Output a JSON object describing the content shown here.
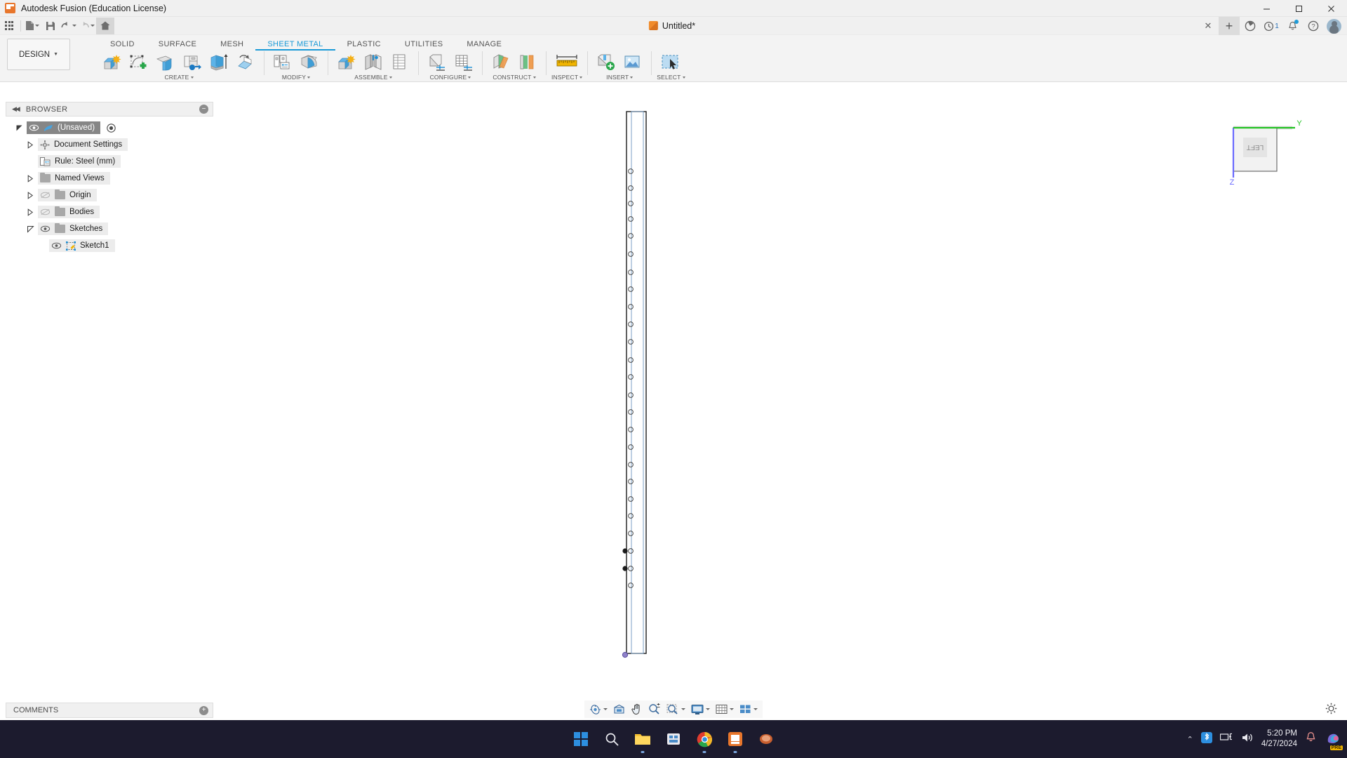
{
  "window": {
    "title": "Autodesk Fusion (Education License)",
    "logo_icon": "fusion-logo-icon",
    "controls": [
      {
        "name": "minimize",
        "glyph": "─"
      },
      {
        "name": "maximize",
        "glyph": "❐"
      },
      {
        "name": "close",
        "glyph": "✕"
      }
    ]
  },
  "quick_access": {
    "items": [
      {
        "name": "app-grid",
        "icon": "grid-icon",
        "caret": false
      },
      {
        "name": "new-document",
        "icon": "file-icon",
        "caret": true
      },
      {
        "name": "save",
        "icon": "save-icon",
        "caret": false
      },
      {
        "name": "undo",
        "icon": "undo-icon",
        "caret": true
      },
      {
        "name": "redo",
        "icon": "redo-icon",
        "caret": true
      },
      {
        "name": "home",
        "icon": "home-icon",
        "caret": false
      }
    ]
  },
  "document_tab": {
    "label": "Untitled*",
    "icon": "document-cube-icon",
    "close_glyph": "✕",
    "new_tab_glyph": "+"
  },
  "tabs_right": {
    "extension_icon": "extension-icon",
    "job_status_icon": "job-status-icon",
    "job_count": "1",
    "notifications_icon": "bell-icon",
    "help_icon": "help-icon",
    "account_icon": "avatar"
  },
  "ribbon": {
    "workspace_label": "DESIGN",
    "workspace_caret": "▼",
    "tabs": [
      {
        "label": "SOLID",
        "active": false
      },
      {
        "label": "SURFACE",
        "active": false
      },
      {
        "label": "MESH",
        "active": false
      },
      {
        "label": "SHEET METAL",
        "active": true
      },
      {
        "label": "PLASTIC",
        "active": false
      },
      {
        "label": "UTILITIES",
        "active": false
      },
      {
        "label": "MANAGE",
        "active": false
      }
    ],
    "panels": [
      {
        "label": "CREATE",
        "has_caret": true,
        "tools": [
          {
            "name": "create-sketch-new-component-icon"
          },
          {
            "name": "create-sketch-icon"
          },
          {
            "name": "flange-icon"
          },
          {
            "name": "contour-flange-icon"
          },
          {
            "name": "extrude-sheet-icon"
          },
          {
            "name": "unfold-icon"
          }
        ]
      },
      {
        "label": "MODIFY",
        "has_caret": true,
        "tools": [
          {
            "name": "sheet-metal-rules-icon"
          },
          {
            "name": "bend-icon"
          }
        ]
      },
      {
        "label": "ASSEMBLE",
        "has_caret": true,
        "tools": [
          {
            "name": "new-component-icon"
          },
          {
            "name": "joint-icon"
          },
          {
            "name": "joint-origin-icon"
          }
        ]
      },
      {
        "label": "CONFIGURE",
        "has_caret": true,
        "tools": [
          {
            "name": "configure-design-icon"
          },
          {
            "name": "configuration-table-icon"
          }
        ]
      },
      {
        "label": "CONSTRUCT",
        "has_caret": true,
        "tools": [
          {
            "name": "offset-plane-icon"
          },
          {
            "name": "plane-along-path-icon"
          }
        ]
      },
      {
        "label": "INSPECT",
        "has_caret": true,
        "tools": [
          {
            "name": "measure-icon"
          }
        ]
      },
      {
        "label": "INSERT",
        "has_caret": true,
        "tools": [
          {
            "name": "insert-mcmaster-icon"
          },
          {
            "name": "canvas-image-icon"
          }
        ]
      },
      {
        "label": "SELECT",
        "has_caret": true,
        "tools": [
          {
            "name": "select-cursor-icon"
          }
        ]
      }
    ]
  },
  "browser": {
    "title": "BROWSER",
    "collapse_icon": "collapse-left-icon",
    "minimize_icon": "minus-circle-icon",
    "tree": [
      {
        "label": "(Unsaved)",
        "indent": 0,
        "expander": "expanded",
        "eye": "visible",
        "icon": "document-icon",
        "selected": true,
        "extra_icon": "activate-radio-icon"
      },
      {
        "label": "Document Settings",
        "indent": 1,
        "expander": "collapsed",
        "eye": "none",
        "icon": "gear-icon",
        "selected": false
      },
      {
        "label": "Rule: Steel (mm)",
        "indent": 2,
        "expander": "none",
        "eye": "none",
        "icon": "rule-icon",
        "selected": false
      },
      {
        "label": "Named Views",
        "indent": 1,
        "expander": "collapsed",
        "eye": "none",
        "icon": "folder-icon",
        "selected": false
      },
      {
        "label": "Origin",
        "indent": 1,
        "expander": "collapsed",
        "eye": "hidden",
        "icon": "folder-icon",
        "selected": false
      },
      {
        "label": "Bodies",
        "indent": 1,
        "expander": "collapsed",
        "eye": "hidden",
        "icon": "folder-icon",
        "selected": false
      },
      {
        "label": "Sketches",
        "indent": 1,
        "expander": "expanded",
        "eye": "visible",
        "icon": "folder-icon",
        "selected": false
      },
      {
        "label": "Sketch1",
        "indent": 2,
        "expander": "none",
        "eye": "visible",
        "icon": "sketch-icon",
        "selected": false
      }
    ]
  },
  "viewcube": {
    "face_label": "LEFT",
    "axis_y_label": "Y",
    "axis_z_label": "Z",
    "axis_y_color": "#22c322",
    "axis_z_color": "#6a6aff"
  },
  "canvas": {
    "sketch_name": "Sketch1",
    "hole_count": 25,
    "selected_point_count": 2,
    "profile_color": "#1c1c1c",
    "construction_color": "#9b9bd6"
  },
  "navbar": {
    "items": [
      {
        "name": "orbit-icon",
        "caret": true
      },
      {
        "name": "pan-home-icon",
        "caret": false
      },
      {
        "name": "pan-icon",
        "caret": false
      },
      {
        "name": "zoom-icon",
        "caret": false
      },
      {
        "name": "zoom-window-icon",
        "caret": true
      },
      {
        "name": "display-settings-icon",
        "caret": true
      },
      {
        "name": "grid-snaps-icon",
        "caret": true
      },
      {
        "name": "viewports-icon",
        "caret": true
      }
    ]
  },
  "comments": {
    "title": "COMMENTS",
    "add_icon": "plus-circle-icon"
  },
  "timeline": {
    "buttons": [
      {
        "name": "timeline-go-start",
        "glyph": "⏮"
      },
      {
        "name": "timeline-step-back",
        "glyph": "◀"
      },
      {
        "name": "timeline-play",
        "glyph": "▶"
      },
      {
        "name": "timeline-step-forward",
        "glyph": "▶"
      },
      {
        "name": "timeline-go-end",
        "glyph": "⏭"
      }
    ],
    "features": [
      {
        "name": "timeline-feature-sketch1",
        "icon": "sketch-icon"
      },
      {
        "name": "timeline-feature-flange",
        "icon": "flange-icon"
      },
      {
        "name": "timeline-marker",
        "icon": "timeline-marker-icon"
      }
    ],
    "settings_icon": "gear-icon"
  },
  "taskbar": {
    "apps": [
      {
        "name": "start-button",
        "icon": "windows-logo-icon",
        "running": false
      },
      {
        "name": "search-button",
        "icon": "search-icon",
        "running": false
      },
      {
        "name": "file-explorer",
        "icon": "folder-icon",
        "running": true
      },
      {
        "name": "store-app",
        "icon": "store-icon",
        "running": false
      },
      {
        "name": "chrome-browser",
        "icon": "chrome-icon",
        "running": true
      },
      {
        "name": "fusion-app",
        "icon": "fusion-icon",
        "running": true
      },
      {
        "name": "other-app",
        "icon": "app-icon",
        "running": false
      }
    ],
    "tray": {
      "chevron": "⌃",
      "bluetooth_icon": "bluetooth-icon",
      "network_icon": "network-icon",
      "volume_icon": "volume-icon",
      "time": "5:20 PM",
      "date": "4/27/2024",
      "notification_icon": "bell-icon",
      "copilot_icon": "copilot-icon",
      "copilot_badge": "PRE"
    }
  }
}
